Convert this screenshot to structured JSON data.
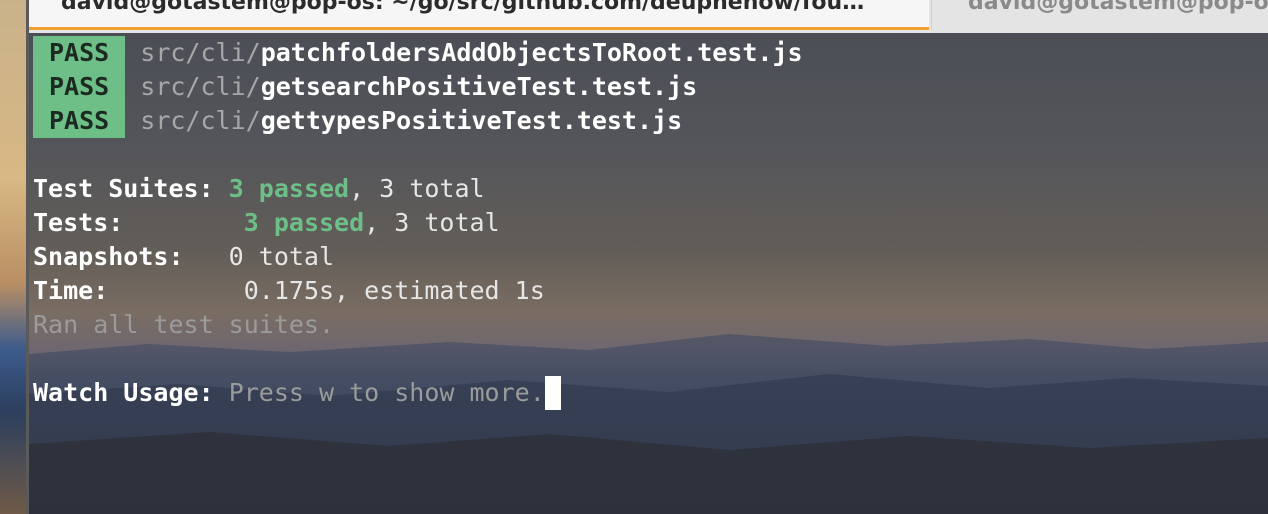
{
  "tabs": [
    {
      "label": "david@gotastem@pop-os: ~/go/src/github.com/deuphenow/fou…",
      "active": true
    },
    {
      "label": "david@gotastem@pop-os",
      "active": false
    }
  ],
  "test_results": [
    {
      "status": "PASS",
      "dir": "src/cli/",
      "file": "patchfoldersAddObjectsToRoot.test.js"
    },
    {
      "status": "PASS",
      "dir": "src/cli/",
      "file": "getsearchPositiveTest.test.js"
    },
    {
      "status": "PASS",
      "dir": "src/cli/",
      "file": "gettypesPositiveTest.test.js"
    }
  ],
  "summary": {
    "suites_label": "Test Suites:",
    "suites_passed": "3 passed",
    "suites_total": ", 3 total",
    "tests_label": "Tests:",
    "tests_passed": "3 passed",
    "tests_total": ", 3 total",
    "snapshots_label": "Snapshots:",
    "snapshots_value": "0 total",
    "time_label": "Time:",
    "time_value": "0.175s, estimated 1s",
    "ran_all": "Ran all test suites."
  },
  "watch": {
    "label": "Watch Usage:",
    "hint": "Press w to show more."
  },
  "colors": {
    "pass_badge": "#6dbf87",
    "tab_accent": "#f0a030"
  }
}
